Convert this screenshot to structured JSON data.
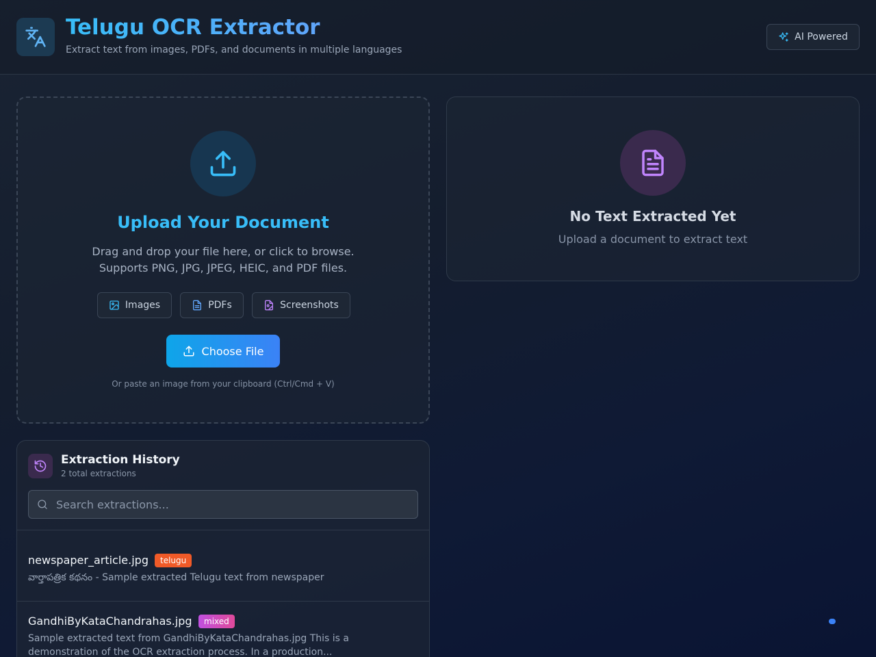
{
  "header": {
    "title": "Telugu OCR Extractor",
    "subtitle": "Extract text from images, PDFs, and documents in multiple languages",
    "badge": "AI Powered"
  },
  "upload": {
    "title": "Upload Your Document",
    "description_line1": "Drag and drop your file here, or click to browse.",
    "description_line2": "Supports PNG, JPG, JPEG, HEIC, and PDF files.",
    "chips": [
      "Images",
      "PDFs",
      "Screenshots"
    ],
    "choose_button": "Choose File",
    "paste_hint": "Or paste an image from your clipboard (Ctrl/Cmd + V)"
  },
  "result": {
    "title": "No Text Extracted Yet",
    "subtitle": "Upload a document to extract text"
  },
  "history": {
    "title": "Extraction History",
    "count": "2 total extractions",
    "search_placeholder": "Search extractions...",
    "items": [
      {
        "name": "newspaper_article.jpg",
        "tag": "telugu",
        "text": "వార్తాపత్రిక కథనం - Sample extracted Telugu text from newspaper"
      },
      {
        "name": "GandhiByKataChandrahas.jpg",
        "tag": "mixed",
        "text": "Sample extracted text from GandhiByKataChandrahas.jpg This is a demonstration of the OCR extraction process. In a production..."
      }
    ]
  },
  "colors": {
    "accent": "#38bdf8",
    "button_gradient_start": "#0ea5e9",
    "button_gradient_end": "#3b82f6",
    "tag_telugu": "#f05a28",
    "tag_mixed_start": "#c050e0",
    "tag_mixed_end": "#e04a9a"
  }
}
